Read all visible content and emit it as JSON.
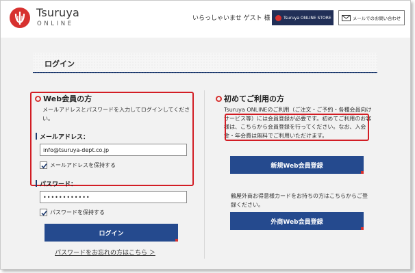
{
  "header": {
    "brand_name": "Tsuruya",
    "brand_sub": "ONLINE",
    "greeting": "いらっしゃいませ ゲスト 様",
    "store_button": "Tsuruya ONLINE STORE",
    "contact_button": "メールでのお問い合わせ"
  },
  "page": {
    "title": "ログイン"
  },
  "member": {
    "heading": "Web会員の方",
    "description": "メールアドレスとパスワードを入力してログインしてください。",
    "email_label": "メールアドレス：",
    "email_value": "info@tsuruya-dept.co.jp",
    "keep_email": "メールアドレスを保持する",
    "password_label": "パスワード：",
    "password_value": "••••••••••••",
    "keep_password": "パスワードを保持する",
    "login_button": "ログイン",
    "forgot_link": "パスワードをお忘れの方はこちら ＞"
  },
  "newuser": {
    "heading": "初めてご利用の方",
    "description": "Tsuruya ONLINEのご利用（ご注文・ご予約・各種会員向けサービス等）には会員登録が必要です。初めてご利用のお客様は、こちらから会員登録を行ってください。なお、入会金・年会費は無料でご利用いただけます。",
    "register_button": "新規Web会員登録",
    "card_description": "鶴屋外商お得意様カードをお持ちの方はこちらからご登録ください。",
    "gaisho_button": "外商Web会員登録"
  },
  "colors": {
    "brand_red": "#d7312f",
    "navy": "#212f57",
    "button_blue": "#254a8e",
    "highlight_red": "#d21d24"
  },
  "state": {
    "keep_email_checked": true,
    "keep_password_checked": true
  }
}
